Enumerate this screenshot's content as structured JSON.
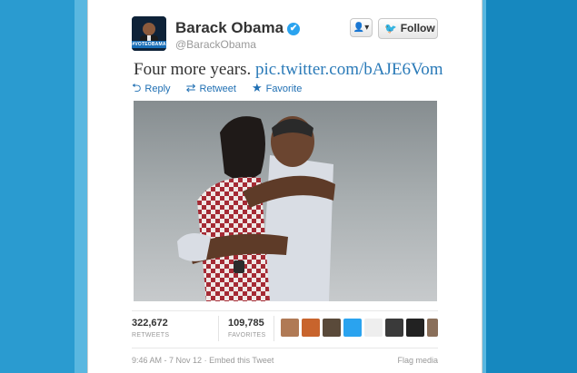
{
  "tweet": {
    "name": "Barack Obama",
    "handle": "@BarackObama",
    "avatar_badge": "#VOTEOBAMA",
    "text": "Four more years.",
    "link": "pic.twitter.com/bAJE6Vom",
    "follow_label": "Follow",
    "actions": {
      "reply": "Reply",
      "retweet": "Retweet",
      "favorite": "Favorite"
    },
    "stats": {
      "retweets_count": "322,672",
      "retweets_label": "RETWEETS",
      "favorites_count": "109,785",
      "favorites_label": "FAVORITES"
    },
    "footer": {
      "time": "9:46 AM - 7 Nov 12",
      "embed": "Embed this Tweet",
      "flag": "Flag media"
    }
  },
  "icons": {
    "verified": "verified-check-icon",
    "user_menu": "user-dropdown-icon",
    "follow": "twitter-bird-icon",
    "reply": "reply-arrow-icon",
    "retweet": "retweet-icon",
    "favorite": "star-icon"
  },
  "colors": {
    "link": "#2a7ab8",
    "action": "#1f6fb3",
    "page_background": "#1d8dc3"
  }
}
